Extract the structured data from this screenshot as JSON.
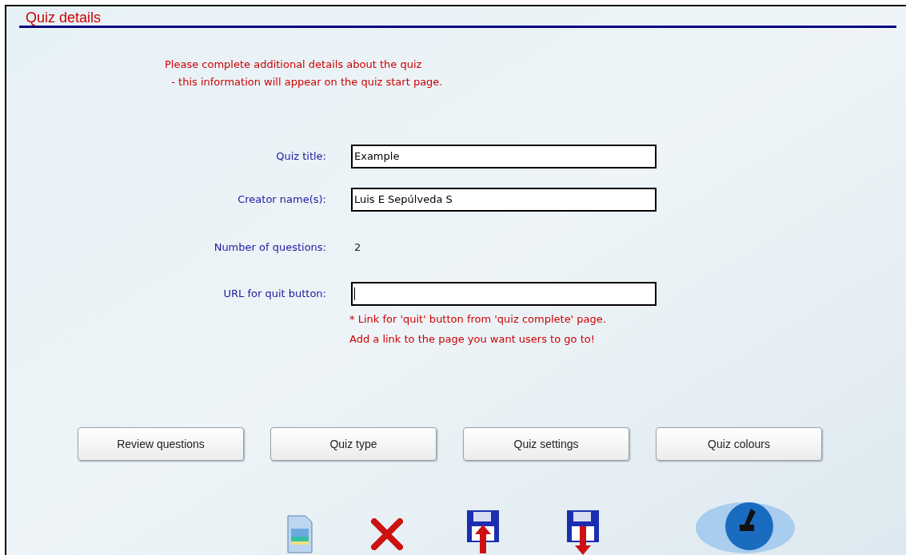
{
  "header": {
    "title": "Quiz details"
  },
  "intro": [
    "Please complete additional details about the quiz",
    "  - this information will appear on the quiz start page."
  ],
  "fields": [
    {
      "kind": "input",
      "label": "Quiz title:",
      "value": "Example"
    },
    {
      "kind": "input",
      "label": "Creator name(s):",
      "value": "Luis E Sepúlveda S"
    },
    {
      "kind": "text",
      "label": "Number of questions:",
      "value": "2"
    },
    {
      "kind": "input",
      "label": "URL for quit button:",
      "focused": true
    }
  ],
  "hint": [
    "* Link for 'quit' button from 'quiz complete' page.",
    "Add a link to the page you want users to go to!"
  ],
  "buttons": [
    "Review questions",
    "Quiz type",
    "Quiz settings",
    "Quiz colours"
  ]
}
